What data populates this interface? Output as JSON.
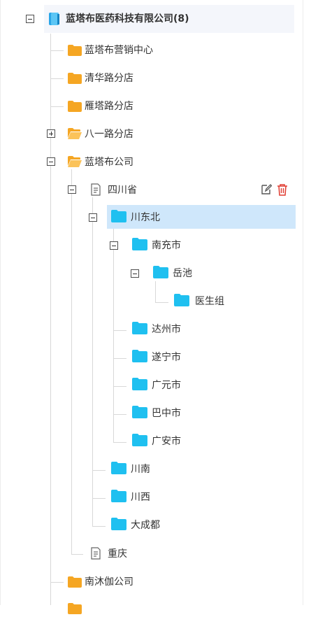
{
  "tree": {
    "root": {
      "label": "蓝塔布医药科技有限公司(8)"
    },
    "nodes": {
      "yingxiao": "蓝塔布营销中心",
      "qinghua": "清华路分店",
      "yanta": "雁塔路分店",
      "bayi": "八一路分店",
      "gongsi": "蓝塔布公司",
      "sichuan": "四川省",
      "chuandongbei": "川东北",
      "nanchong": "南充市",
      "yuechi": "岳池",
      "yishengzu": "医生组",
      "dazhou": "达州市",
      "suining": "遂宁市",
      "guangyuan": "广元市",
      "bazhong": "巴中市",
      "guangan": "广安市",
      "chuannan": "川南",
      "chuanxi": "川西",
      "dachengdu": "大成都",
      "chongqing": "重庆",
      "nanmujia": "南沐伽公司"
    },
    "colors": {
      "folder_orange": "#f5a623",
      "folder_cyan": "#1fc0f0",
      "selected_bg": "#cfe7fb",
      "delete_red": "#e03c31"
    }
  }
}
